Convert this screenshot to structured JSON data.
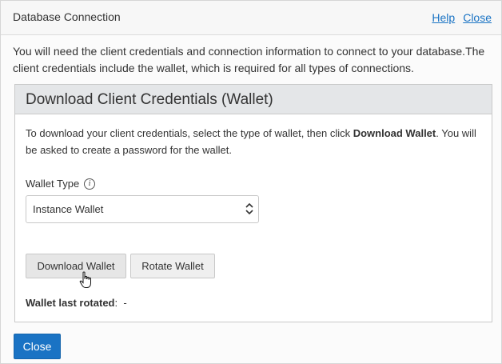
{
  "header": {
    "title": "Database Connection",
    "help_link": "Help",
    "close_link": "Close"
  },
  "intro": "You will need the client credentials and connection information to connect to your database.The client credentials include the wallet, which is required for all types of connections.",
  "panel": {
    "title": "Download Client Credentials (Wallet)",
    "description_part1": "To download your client credentials, select the type of wallet, then click ",
    "description_bold": "Download Wallet",
    "description_part2": ". You will be asked to create a password for the wallet.",
    "wallet_type_label": "Wallet Type",
    "wallet_type_value": "Instance Wallet",
    "download_button": "Download Wallet",
    "rotate_button": "Rotate Wallet",
    "last_rotated_label": "Wallet last rotated",
    "last_rotated_value": "-"
  },
  "footer": {
    "close_button": "Close"
  },
  "colors": {
    "accent": "#1a73c4",
    "panel_header_bg": "#e4e6e8"
  }
}
